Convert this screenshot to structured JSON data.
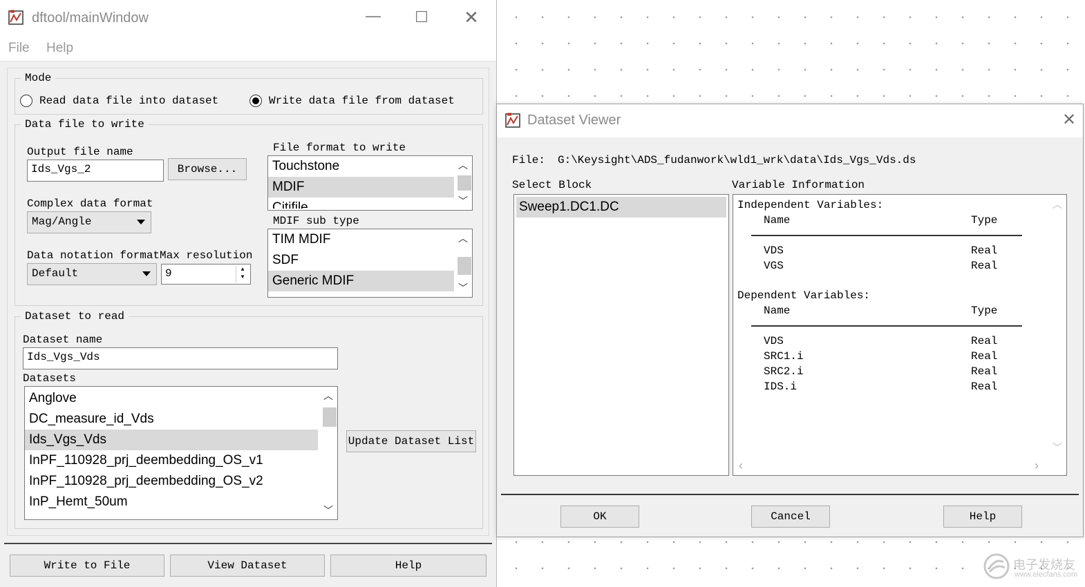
{
  "main_window": {
    "title": "dftool/mainWindow",
    "menu": [
      "File",
      "Help"
    ],
    "mode": {
      "legend": "Mode",
      "option_read": "Read data file into dataset",
      "option_write": "Write data file from dataset",
      "selected": "write"
    },
    "data_file_group": {
      "legend": "Data file to write",
      "output_file_label": "Output file name",
      "output_file_value": "Ids_Vgs_2",
      "browse_label": "Browse...",
      "complex_format_label": "Complex data format",
      "complex_format_value": "Mag/Angle",
      "notation_label": "Data notation format",
      "notation_value": "Default",
      "max_res_label": "Max resolution",
      "max_res_value": "9",
      "file_format_label": "File format to write",
      "file_formats": [
        "Touchstone",
        "MDIF",
        "Citifile"
      ],
      "file_format_selected": "MDIF",
      "mdif_subtype_label": "MDIF sub type",
      "mdif_subtypes": [
        "TIM MDIF",
        "SDF",
        "Generic MDIF"
      ],
      "mdif_subtype_selected": "Generic MDIF"
    },
    "dataset_group": {
      "legend": "Dataset to read",
      "name_label": "Dataset name",
      "name_value": "Ids_Vgs_Vds",
      "datasets_label": "Datasets",
      "datasets": [
        "Anglove",
        "DC_measure_id_Vds",
        "Ids_Vgs_Vds",
        "InPF_110928_prj_deembedding_OS_v1",
        "InPF_110928_prj_deembedding_OS_v2",
        "InP_Hemt_50um"
      ],
      "selected": "Ids_Vgs_Vds",
      "update_button": "Update Dataset List"
    },
    "buttons": {
      "write": "Write to File",
      "view": "View Dataset",
      "help": "Help"
    }
  },
  "dataset_viewer": {
    "title": "Dataset Viewer",
    "file_label": "File:",
    "file_path": "G:\\Keysight\\ADS_fudanwork\\wld1_wrk\\data\\Ids_Vgs_Vds.ds",
    "select_block_label": "Select Block",
    "blocks": [
      "Sweep1.DC1.DC"
    ],
    "variable_info_label": "Variable Information",
    "independent_header": "Independent Variables:",
    "dependent_header": "Dependent Variables:",
    "col_name": "Name",
    "col_type": "Type",
    "independent": [
      {
        "name": "VDS",
        "type": "Real"
      },
      {
        "name": "VGS",
        "type": "Real"
      }
    ],
    "dependent": [
      {
        "name": "VDS",
        "type": "Real"
      },
      {
        "name": "SRC1.i",
        "type": "Real"
      },
      {
        "name": "SRC2.i",
        "type": "Real"
      },
      {
        "name": "IDS.i",
        "type": "Real"
      }
    ],
    "buttons": {
      "ok": "OK",
      "cancel": "Cancel",
      "help": "Help"
    }
  },
  "watermark": {
    "cn": "电子发烧友",
    "url": "www.elecfans.com"
  }
}
